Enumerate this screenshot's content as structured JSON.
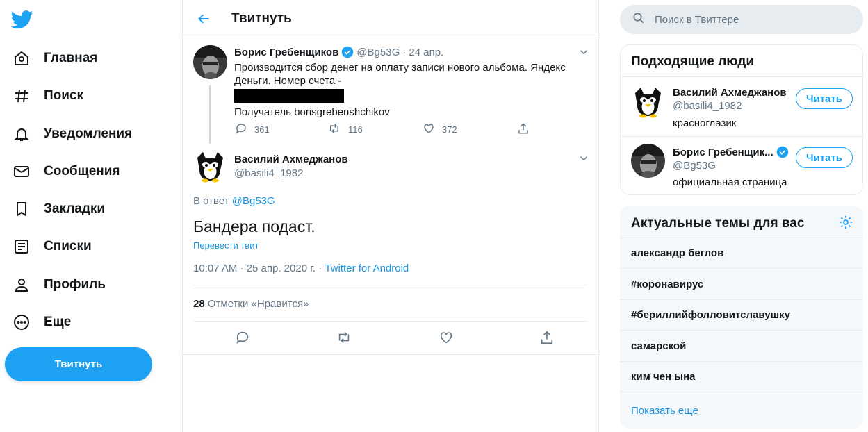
{
  "nav": {
    "items": [
      {
        "label": "Главная",
        "icon": "home-icon"
      },
      {
        "label": "Поиск",
        "icon": "hashtag-icon"
      },
      {
        "label": "Уведомления",
        "icon": "bell-icon"
      },
      {
        "label": "Сообщения",
        "icon": "mail-icon"
      },
      {
        "label": "Закладки",
        "icon": "bookmark-icon"
      },
      {
        "label": "Списки",
        "icon": "list-icon"
      },
      {
        "label": "Профиль",
        "icon": "profile-icon"
      },
      {
        "label": "Еще",
        "icon": "more-icon"
      }
    ],
    "tweet_button": "Твитнуть"
  },
  "header": {
    "title": "Твитнуть"
  },
  "parent_tweet": {
    "name": "Борис Гребенщиков",
    "handle": "@Bg53G",
    "date": "· 24 апр.",
    "text_line1": "Производится сбор денег на оплату записи нового альбома. Яндекс",
    "text_line2": "Деньги. Номер счета -",
    "text_line3": "Получатель borisgrebenshchikov",
    "replies": "361",
    "retweets": "116",
    "likes": "372"
  },
  "main_tweet": {
    "name": "Василий Ахмеджанов",
    "handle": "@basili4_1982",
    "reply_prefix": "В ответ",
    "reply_to": "@Bg53G",
    "text": "Бандера подаст.",
    "translate": "Перевести твит",
    "time": "10:07 AM · 25 апр. 2020 г. ·",
    "source": "Twitter for Android",
    "likes_count": "28",
    "likes_label": "Отметки «Нравится»"
  },
  "search": {
    "placeholder": "Поиск в Твиттере"
  },
  "who_to_follow": {
    "title": "Подходящие люди",
    "users": [
      {
        "name": "Василий Ахмеджанов",
        "handle": "@basili4_1982",
        "bio": "красноглазик",
        "button": "Читать"
      },
      {
        "name": "Борис Гребенщик...",
        "handle": "@Bg53G",
        "bio": "официальная страница",
        "button": "Читать"
      }
    ]
  },
  "trends": {
    "title": "Актуальные темы для вас",
    "items": [
      "александр беглов",
      "#коронавирус",
      "#бериллийфолловитславушку",
      "самарской",
      "ким чен ына"
    ],
    "show_more": "Показать еще"
  },
  "colors": {
    "accent": "#1da1f2",
    "text": "#14171a",
    "muted": "#657786",
    "border": "#e6ecf0"
  }
}
